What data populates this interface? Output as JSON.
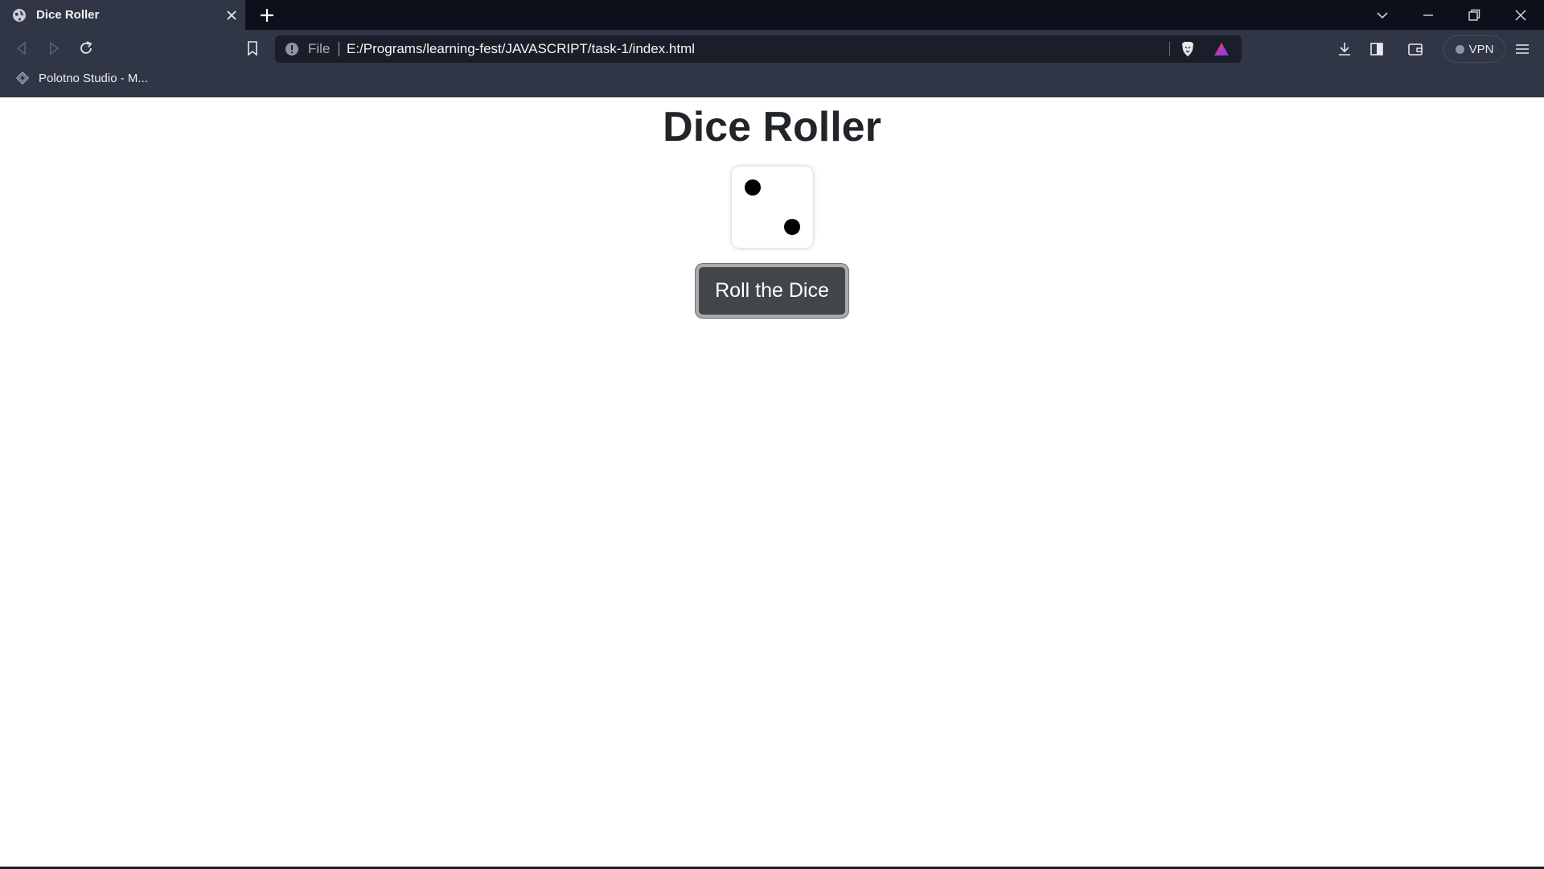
{
  "browser": {
    "tab": {
      "title": "Dice Roller",
      "favicon": "globe-icon"
    },
    "address_bar": {
      "scheme_label": "File",
      "url": "E:/Programs/learning-fest/JAVASCRIPT/task-1/index.html"
    },
    "vpn_label": "VPN",
    "bookmarks": [
      {
        "label": "Polotno Studio - M...",
        "icon": "polotno-icon"
      }
    ]
  },
  "page": {
    "heading": "Dice Roller",
    "die": {
      "face_value": 2
    },
    "roll_button_label": "Roll the Dice"
  }
}
